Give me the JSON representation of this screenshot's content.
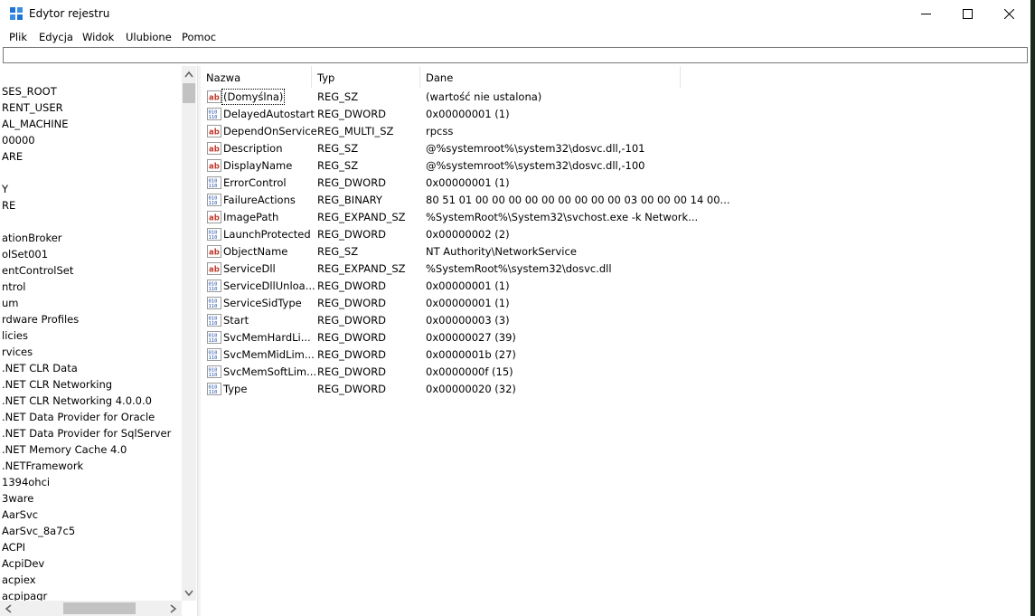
{
  "window": {
    "title": "Edytor rejestru"
  },
  "menu": [
    "Plik",
    "Edycja",
    "Widok",
    "Ulubione",
    "Pomoc"
  ],
  "tree": [
    "SES_ROOT",
    "RENT_USER",
    "AL_MACHINE",
    "00000",
    "ARE",
    "",
    "Y",
    "RE",
    "",
    "ationBroker",
    "olSet001",
    "entControlSet",
    "ntrol",
    "um",
    "rdware Profiles",
    "licies",
    "rvices",
    ".NET CLR Data",
    ".NET CLR Networking",
    ".NET CLR Networking 4.0.0.0",
    ".NET Data Provider for Oracle",
    ".NET Data Provider for SqlServer",
    ".NET Memory Cache 4.0",
    ".NETFramework",
    "1394ohci",
    "3ware",
    "AarSvc",
    "AarSvc_8a7c5",
    "ACPI",
    "AcpiDev",
    "acpiex",
    "acpipagr"
  ],
  "columns": {
    "name": "Nazwa",
    "type": "Typ",
    "data": "Dane"
  },
  "values": [
    {
      "name": "(Domyślna)",
      "type": "REG_SZ",
      "data": "(wartość nie ustalona)",
      "icon": "string-value-icon"
    },
    {
      "name": "DelayedAutostart",
      "type": "REG_DWORD",
      "data": "0x00000001 (1)",
      "icon": "binary-value-icon"
    },
    {
      "name": "DependOnService",
      "type": "REG_MULTI_SZ",
      "data": "rpcss",
      "icon": "string-value-icon"
    },
    {
      "name": "Description",
      "type": "REG_SZ",
      "data": "@%systemroot%\\system32\\dosvc.dll,-101",
      "icon": "string-value-icon"
    },
    {
      "name": "DisplayName",
      "type": "REG_SZ",
      "data": "@%systemroot%\\system32\\dosvc.dll,-100",
      "icon": "string-value-icon"
    },
    {
      "name": "ErrorControl",
      "type": "REG_DWORD",
      "data": "0x00000001 (1)",
      "icon": "binary-value-icon"
    },
    {
      "name": "FailureActions",
      "type": "REG_BINARY",
      "data": "80 51 01 00 00 00 00 00 00 00 00 00 03 00 00 00 14 00...",
      "icon": "binary-value-icon"
    },
    {
      "name": "ImagePath",
      "type": "REG_EXPAND_SZ",
      "data": "%SystemRoot%\\System32\\svchost.exe -k Network...",
      "icon": "string-value-icon"
    },
    {
      "name": "LaunchProtected",
      "type": "REG_DWORD",
      "data": "0x00000002 (2)",
      "icon": "binary-value-icon"
    },
    {
      "name": "ObjectName",
      "type": "REG_SZ",
      "data": "NT Authority\\NetworkService",
      "icon": "string-value-icon"
    },
    {
      "name": "ServiceDll",
      "type": "REG_EXPAND_SZ",
      "data": "%SystemRoot%\\system32\\dosvc.dll",
      "icon": "string-value-icon"
    },
    {
      "name": "ServiceDllUnloa...",
      "type": "REG_DWORD",
      "data": "0x00000001 (1)",
      "icon": "binary-value-icon"
    },
    {
      "name": "ServiceSidType",
      "type": "REG_DWORD",
      "data": "0x00000001 (1)",
      "icon": "binary-value-icon"
    },
    {
      "name": "Start",
      "type": "REG_DWORD",
      "data": "0x00000003 (3)",
      "icon": "binary-value-icon"
    },
    {
      "name": "SvcMemHardLi...",
      "type": "REG_DWORD",
      "data": "0x00000027 (39)",
      "icon": "binary-value-icon"
    },
    {
      "name": "SvcMemMidLim...",
      "type": "REG_DWORD",
      "data": "0x0000001b (27)",
      "icon": "binary-value-icon"
    },
    {
      "name": "SvcMemSoftLim...",
      "type": "REG_DWORD",
      "data": "0x0000000f (15)",
      "icon": "binary-value-icon"
    },
    {
      "name": "Type",
      "type": "REG_DWORD",
      "data": "0x00000020 (32)",
      "icon": "binary-value-icon"
    }
  ]
}
